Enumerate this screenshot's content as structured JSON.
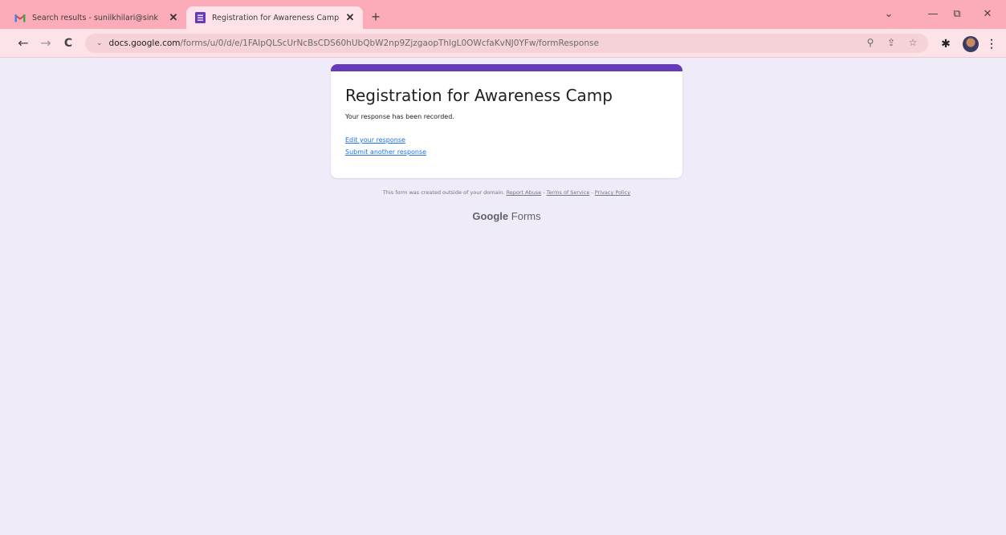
{
  "tabs": [
    {
      "title": "Search results - sunilkhilari@sink",
      "icon": "gmail-icon"
    },
    {
      "title": "Registration for Awareness Camp",
      "icon": "forms-icon"
    }
  ],
  "new_tab": "+",
  "window": {
    "dropdown": "⌄",
    "minimize": "—",
    "restore": "⧉",
    "close": "✕"
  },
  "nav": {
    "back": "←",
    "forward": "→",
    "reload": "C",
    "omni_indicator": "⌄"
  },
  "address": {
    "host": "docs.google.com",
    "path": "/forms/u/0/d/e/1FAIpQLScUrNcBsCDS60hUbQbW2np9ZjzgaopThlgL0OWcfaKvNJ0YFw/formResponse"
  },
  "omnibox_icons": {
    "zoom": "⚲",
    "share": "⇪",
    "star": "☆"
  },
  "extensions": {
    "puzzle": "✱",
    "menu": "⋮"
  },
  "form": {
    "title": "Registration for Awareness Camp",
    "message": "Your response has been recorded.",
    "edit_link": "Edit your response",
    "another_link": "Submit another response"
  },
  "footer": {
    "note": "This form was created outside of your domain.",
    "report": "Report Abuse",
    "terms": "Terms of Service",
    "privacy": "Privacy Policy",
    "sep": " - "
  },
  "brand": {
    "google": "Google",
    "forms": " Forms"
  },
  "colors": {
    "accent": "#673ab7",
    "page_bg": "#f0ebf8",
    "tabbar": "#fcabb8",
    "link": "#1a73e8"
  }
}
